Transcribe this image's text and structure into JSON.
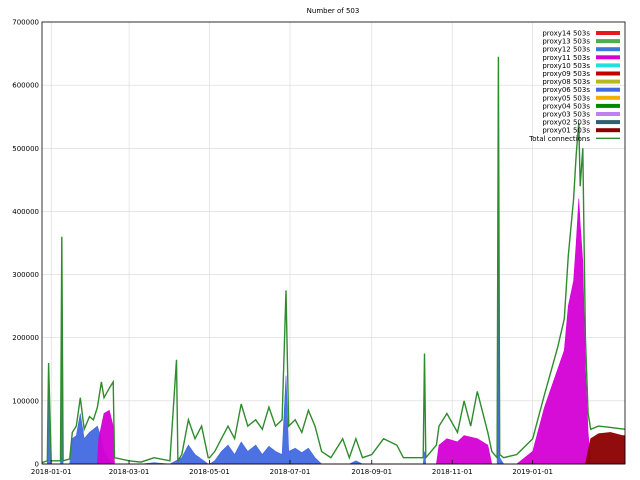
{
  "chart_data": {
    "type": "area",
    "title": "Number of 503",
    "xlabel": "",
    "ylabel": "",
    "ylim": [
      0,
      700000
    ],
    "y_ticks": [
      0,
      100000,
      200000,
      300000,
      400000,
      500000,
      600000,
      700000
    ],
    "x_range": [
      "2017-12-25",
      "2019-03-12"
    ],
    "x_ticks": [
      "2018-01-01",
      "2018-03-01",
      "2018-05-01",
      "2018-07-01",
      "2018-09-01",
      "2018-11-01",
      "2019-01-01"
    ],
    "grid": true,
    "legend_position": "top-right",
    "legend": [
      {
        "label": "proxy14 503s",
        "color": "#e41a1c"
      },
      {
        "label": "proxy13 503s",
        "color": "#4daf4a"
      },
      {
        "label": "proxy12 503s",
        "color": "#3a7bd5"
      },
      {
        "label": "proxy11 503s",
        "color": "#d400d4"
      },
      {
        "label": "proxy10 503s",
        "color": "#22e0e0"
      },
      {
        "label": "proxy09 503s",
        "color": "#c00000"
      },
      {
        "label": "proxy08 503s",
        "color": "#b8b820"
      },
      {
        "label": "proxy06 503s",
        "color": "#4169e1"
      },
      {
        "label": "proxy05 503s",
        "color": "#f0b000"
      },
      {
        "label": "proxy04 503s",
        "color": "#008a00"
      },
      {
        "label": "proxy03 503s",
        "color": "#c080f0"
      },
      {
        "label": "proxy02 503s",
        "color": "#2f5f70"
      },
      {
        "label": "proxy01 503s",
        "color": "#8b0000"
      },
      {
        "label": "Total connections",
        "color": "#2e8b2e"
      }
    ],
    "series": [
      {
        "name": "proxy06 503s",
        "color": "#4169e1",
        "points": [
          [
            "2017-12-25",
            0
          ],
          [
            "2017-12-29",
            0
          ],
          [
            "2017-12-30",
            120000
          ],
          [
            "2018-01-01",
            0
          ],
          [
            "2018-01-08",
            0
          ],
          [
            "2018-01-09",
            300000
          ],
          [
            "2018-01-10",
            0
          ],
          [
            "2018-01-15",
            0
          ],
          [
            "2018-01-17",
            40000
          ],
          [
            "2018-01-20",
            45000
          ],
          [
            "2018-01-23",
            80000
          ],
          [
            "2018-01-26",
            40000
          ],
          [
            "2018-01-30",
            50000
          ],
          [
            "2018-02-02",
            55000
          ],
          [
            "2018-02-05",
            60000
          ],
          [
            "2018-02-08",
            40000
          ],
          [
            "2018-02-10",
            20000
          ],
          [
            "2018-02-16",
            0
          ],
          [
            "2018-03-10",
            0
          ],
          [
            "2018-03-20",
            2000
          ],
          [
            "2018-04-01",
            0
          ],
          [
            "2018-04-10",
            10000
          ],
          [
            "2018-04-15",
            30000
          ],
          [
            "2018-04-20",
            15000
          ],
          [
            "2018-04-30",
            0
          ],
          [
            "2018-05-01",
            0
          ],
          [
            "2018-05-05",
            5000
          ],
          [
            "2018-05-10",
            20000
          ],
          [
            "2018-05-15",
            30000
          ],
          [
            "2018-05-20",
            15000
          ],
          [
            "2018-05-25",
            35000
          ],
          [
            "2018-05-30",
            20000
          ],
          [
            "2018-06-05",
            30000
          ],
          [
            "2018-06-10",
            15000
          ],
          [
            "2018-06-15",
            28000
          ],
          [
            "2018-06-20",
            20000
          ],
          [
            "2018-06-25",
            15000
          ],
          [
            "2018-06-28",
            140000
          ],
          [
            "2018-06-30",
            20000
          ],
          [
            "2018-07-05",
            25000
          ],
          [
            "2018-07-10",
            18000
          ],
          [
            "2018-07-15",
            25000
          ],
          [
            "2018-07-20",
            10000
          ],
          [
            "2018-07-25",
            0
          ],
          [
            "2018-08-15",
            0
          ],
          [
            "2018-08-20",
            5000
          ],
          [
            "2018-08-25",
            0
          ],
          [
            "2018-10-10",
            0
          ],
          [
            "2018-10-11",
            20000
          ],
          [
            "2018-10-12",
            0
          ],
          [
            "2018-12-05",
            0
          ],
          [
            "2018-12-06",
            600000
          ],
          [
            "2018-12-07",
            10000
          ],
          [
            "2018-12-10",
            0
          ],
          [
            "2019-03-12",
            0
          ]
        ]
      },
      {
        "name": "proxy11 503s",
        "color": "#d400d4",
        "points": [
          [
            "2017-12-25",
            0
          ],
          [
            "2018-02-05",
            0
          ],
          [
            "2018-02-06",
            40000
          ],
          [
            "2018-02-10",
            80000
          ],
          [
            "2018-02-14",
            85000
          ],
          [
            "2018-02-17",
            60000
          ],
          [
            "2018-02-18",
            0
          ],
          [
            "2018-10-20",
            0
          ],
          [
            "2018-10-22",
            30000
          ],
          [
            "2018-10-28",
            40000
          ],
          [
            "2018-11-05",
            35000
          ],
          [
            "2018-11-10",
            45000
          ],
          [
            "2018-11-20",
            40000
          ],
          [
            "2018-11-28",
            30000
          ],
          [
            "2018-12-01",
            0
          ],
          [
            "2018-12-20",
            0
          ],
          [
            "2019-01-01",
            20000
          ],
          [
            "2019-01-10",
            90000
          ],
          [
            "2019-01-20",
            150000
          ],
          [
            "2019-01-25",
            180000
          ],
          [
            "2019-01-28",
            250000
          ],
          [
            "2019-02-01",
            290000
          ],
          [
            "2019-02-03",
            350000
          ],
          [
            "2019-02-05",
            420000
          ],
          [
            "2019-02-06",
            380000
          ],
          [
            "2019-02-08",
            320000
          ],
          [
            "2019-02-10",
            150000
          ],
          [
            "2019-02-12",
            50000
          ],
          [
            "2019-02-14",
            0
          ],
          [
            "2019-03-12",
            0
          ]
        ]
      },
      {
        "name": "proxy01 503s",
        "color": "#8b0000",
        "points": [
          [
            "2017-12-25",
            0
          ],
          [
            "2019-02-10",
            0
          ],
          [
            "2019-02-14",
            40000
          ],
          [
            "2019-02-20",
            48000
          ],
          [
            "2019-03-01",
            50000
          ],
          [
            "2019-03-10",
            45000
          ],
          [
            "2019-03-12",
            45000
          ]
        ]
      },
      {
        "name": "Total connections",
        "color": "#2e8b2e",
        "points": [
          [
            "2017-12-25",
            2000
          ],
          [
            "2017-12-29",
            5000
          ],
          [
            "2017-12-30",
            160000
          ],
          [
            "2018-01-01",
            5000
          ],
          [
            "2018-01-08",
            5000
          ],
          [
            "2018-01-09",
            360000
          ],
          [
            "2018-01-10",
            5000
          ],
          [
            "2018-01-15",
            8000
          ],
          [
            "2018-01-17",
            50000
          ],
          [
            "2018-01-20",
            60000
          ],
          [
            "2018-01-23",
            105000
          ],
          [
            "2018-01-26",
            55000
          ],
          [
            "2018-01-30",
            75000
          ],
          [
            "2018-02-02",
            70000
          ],
          [
            "2018-02-05",
            90000
          ],
          [
            "2018-02-08",
            130000
          ],
          [
            "2018-02-10",
            105000
          ],
          [
            "2018-02-14",
            120000
          ],
          [
            "2018-02-17",
            130000
          ],
          [
            "2018-02-18",
            10000
          ],
          [
            "2018-03-01",
            5000
          ],
          [
            "2018-03-10",
            3000
          ],
          [
            "2018-03-20",
            10000
          ],
          [
            "2018-04-01",
            5000
          ],
          [
            "2018-04-06",
            165000
          ],
          [
            "2018-04-07",
            5000
          ],
          [
            "2018-04-10",
            15000
          ],
          [
            "2018-04-15",
            70000
          ],
          [
            "2018-04-20",
            40000
          ],
          [
            "2018-04-25",
            60000
          ],
          [
            "2018-04-30",
            10000
          ],
          [
            "2018-05-01",
            10000
          ],
          [
            "2018-05-05",
            20000
          ],
          [
            "2018-05-10",
            40000
          ],
          [
            "2018-05-15",
            60000
          ],
          [
            "2018-05-20",
            40000
          ],
          [
            "2018-05-25",
            95000
          ],
          [
            "2018-05-30",
            60000
          ],
          [
            "2018-06-05",
            70000
          ],
          [
            "2018-06-10",
            55000
          ],
          [
            "2018-06-15",
            90000
          ],
          [
            "2018-06-20",
            60000
          ],
          [
            "2018-06-25",
            70000
          ],
          [
            "2018-06-28",
            275000
          ],
          [
            "2018-06-30",
            60000
          ],
          [
            "2018-07-05",
            70000
          ],
          [
            "2018-07-10",
            50000
          ],
          [
            "2018-07-15",
            85000
          ],
          [
            "2018-07-20",
            60000
          ],
          [
            "2018-07-25",
            20000
          ],
          [
            "2018-08-01",
            10000
          ],
          [
            "2018-08-10",
            40000
          ],
          [
            "2018-08-15",
            10000
          ],
          [
            "2018-08-20",
            40000
          ],
          [
            "2018-08-25",
            10000
          ],
          [
            "2018-09-01",
            15000
          ],
          [
            "2018-09-10",
            40000
          ],
          [
            "2018-09-20",
            30000
          ],
          [
            "2018-09-25",
            10000
          ],
          [
            "2018-10-10",
            10000
          ],
          [
            "2018-10-11",
            175000
          ],
          [
            "2018-10-12",
            10000
          ],
          [
            "2018-10-20",
            30000
          ],
          [
            "2018-10-22",
            60000
          ],
          [
            "2018-10-28",
            80000
          ],
          [
            "2018-11-05",
            50000
          ],
          [
            "2018-11-10",
            100000
          ],
          [
            "2018-11-15",
            60000
          ],
          [
            "2018-11-20",
            115000
          ],
          [
            "2018-11-28",
            50000
          ],
          [
            "2018-12-01",
            20000
          ],
          [
            "2018-12-05",
            10000
          ],
          [
            "2018-12-06",
            645000
          ],
          [
            "2018-12-07",
            15000
          ],
          [
            "2018-12-10",
            10000
          ],
          [
            "2018-12-20",
            15000
          ],
          [
            "2019-01-01",
            40000
          ],
          [
            "2019-01-10",
            110000
          ],
          [
            "2019-01-20",
            185000
          ],
          [
            "2019-01-25",
            230000
          ],
          [
            "2019-01-28",
            330000
          ],
          [
            "2019-02-01",
            420000
          ],
          [
            "2019-02-03",
            490000
          ],
          [
            "2019-02-05",
            540000
          ],
          [
            "2019-02-06",
            440000
          ],
          [
            "2019-02-08",
            500000
          ],
          [
            "2019-02-10",
            200000
          ],
          [
            "2019-02-12",
            80000
          ],
          [
            "2019-02-14",
            55000
          ],
          [
            "2019-02-20",
            60000
          ],
          [
            "2019-03-01",
            58000
          ],
          [
            "2019-03-12",
            55000
          ]
        ]
      }
    ]
  }
}
